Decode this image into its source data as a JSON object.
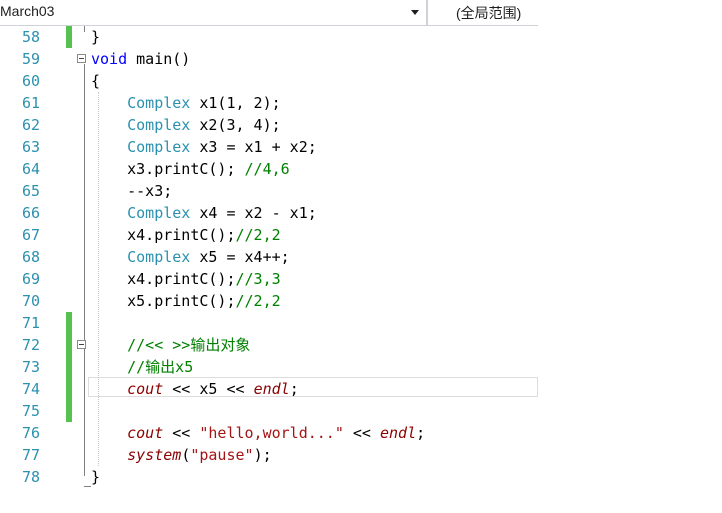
{
  "toolbar": {
    "scope_dropdown": "March03",
    "scope_label": "(全局范围)"
  },
  "editor": {
    "lines": [
      {
        "num": "58",
        "tokens": [
          {
            "t": "}",
            "c": "pl"
          }
        ]
      },
      {
        "num": "59",
        "tokens": [
          {
            "t": "void",
            "c": "kw"
          },
          {
            "t": " main()",
            "c": "pl"
          }
        ]
      },
      {
        "num": "60",
        "tokens": [
          {
            "t": "{",
            "c": "pl"
          }
        ]
      },
      {
        "num": "61",
        "tokens": [
          {
            "t": "    ",
            "c": "pl"
          },
          {
            "t": "Complex",
            "c": "ty"
          },
          {
            "t": " x1(1, 2);",
            "c": "pl"
          }
        ]
      },
      {
        "num": "62",
        "tokens": [
          {
            "t": "    ",
            "c": "pl"
          },
          {
            "t": "Complex",
            "c": "ty"
          },
          {
            "t": " x2(3, 4);",
            "c": "pl"
          }
        ]
      },
      {
        "num": "63",
        "tokens": [
          {
            "t": "    ",
            "c": "pl"
          },
          {
            "t": "Complex",
            "c": "ty"
          },
          {
            "t": " x3 = x1 + x2;",
            "c": "pl"
          }
        ]
      },
      {
        "num": "64",
        "tokens": [
          {
            "t": "    x3.printC(); ",
            "c": "pl"
          },
          {
            "t": "//4,6",
            "c": "cm"
          }
        ]
      },
      {
        "num": "65",
        "tokens": [
          {
            "t": "    --x3;",
            "c": "pl"
          }
        ]
      },
      {
        "num": "66",
        "tokens": [
          {
            "t": "    ",
            "c": "pl"
          },
          {
            "t": "Complex",
            "c": "ty"
          },
          {
            "t": " x4 = x2 - x1;",
            "c": "pl"
          }
        ]
      },
      {
        "num": "67",
        "tokens": [
          {
            "t": "    x4.printC();",
            "c": "pl"
          },
          {
            "t": "//2,2",
            "c": "cm"
          }
        ]
      },
      {
        "num": "68",
        "tokens": [
          {
            "t": "    ",
            "c": "pl"
          },
          {
            "t": "Complex",
            "c": "ty"
          },
          {
            "t": " x5 = x4++;",
            "c": "pl"
          }
        ]
      },
      {
        "num": "69",
        "tokens": [
          {
            "t": "    x4.printC();",
            "c": "pl"
          },
          {
            "t": "//3,3",
            "c": "cm"
          }
        ]
      },
      {
        "num": "70",
        "tokens": [
          {
            "t": "    x5.printC();",
            "c": "pl"
          },
          {
            "t": "//2,2",
            "c": "cm"
          }
        ]
      },
      {
        "num": "71",
        "tokens": []
      },
      {
        "num": "72",
        "tokens": [
          {
            "t": "    ",
            "c": "pl"
          },
          {
            "t": "//<< >>输出对象",
            "c": "cm"
          }
        ]
      },
      {
        "num": "73",
        "tokens": [
          {
            "t": "    ",
            "c": "pl"
          },
          {
            "t": "//输出x5",
            "c": "cm"
          }
        ]
      },
      {
        "num": "74",
        "tokens": [
          {
            "t": "    ",
            "c": "pl"
          },
          {
            "t": "cout",
            "c": "it"
          },
          {
            "t": " << x5 << ",
            "c": "pl"
          },
          {
            "t": "endl",
            "c": "it"
          },
          {
            "t": ";",
            "c": "pl"
          }
        ]
      },
      {
        "num": "75",
        "tokens": []
      },
      {
        "num": "76",
        "tokens": [
          {
            "t": "    ",
            "c": "pl"
          },
          {
            "t": "cout",
            "c": "it"
          },
          {
            "t": " << ",
            "c": "pl"
          },
          {
            "t": "\"hello,world...\"",
            "c": "st"
          },
          {
            "t": " << ",
            "c": "pl"
          },
          {
            "t": "endl",
            "c": "it"
          },
          {
            "t": ";",
            "c": "pl"
          }
        ]
      },
      {
        "num": "77",
        "tokens": [
          {
            "t": "    ",
            "c": "pl"
          },
          {
            "t": "system",
            "c": "it"
          },
          {
            "t": "(",
            "c": "pl"
          },
          {
            "t": "\"pause\"",
            "c": "st"
          },
          {
            "t": ");",
            "c": "pl"
          }
        ]
      },
      {
        "num": "78",
        "tokens": [
          {
            "t": "}",
            "c": "pl"
          }
        ]
      }
    ]
  },
  "colors": {
    "keyword": "#0000ff",
    "type": "#2b91af",
    "comment": "#008000",
    "identifier_italic": "#8b0000",
    "string": "#a31515",
    "line_number": "#2b91af",
    "change_bar": "#57c24f"
  },
  "icons": [
    "chevron-down-icon",
    "collapse-icon"
  ]
}
